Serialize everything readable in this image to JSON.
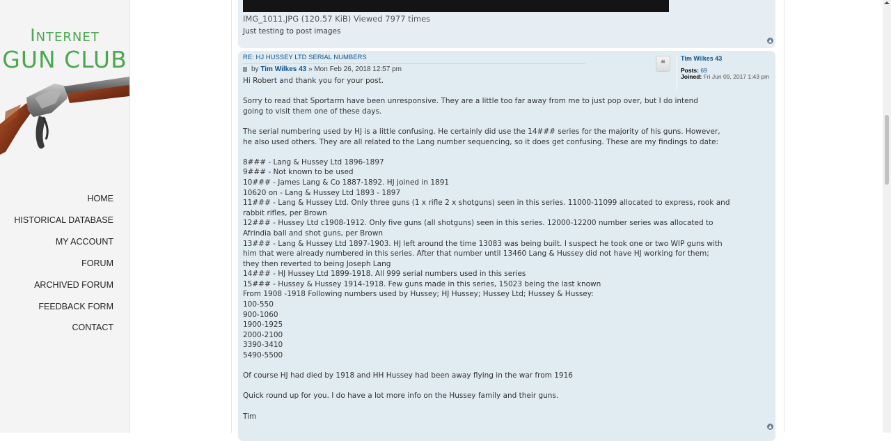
{
  "logo": {
    "line1": "Internet",
    "line2": "GUN CLUB"
  },
  "nav": {
    "home": "HOME",
    "historical_database": "HISTORICAL DATABASE",
    "my_account": "MY ACCOUNT",
    "forum": "FORUM",
    "archived_forum": "ARCHIVED FORUM",
    "feedback_form": "FEEDBACK FORM",
    "contact": "CONTACT"
  },
  "post1": {
    "attachment_caption": "IMG_1011.JPG (120.57 KiB) Viewed 7977 times",
    "text": "Just testing to post images"
  },
  "post2": {
    "title": "Re: HJ Hussey Ltd serial numbers",
    "by_label": "by",
    "author": "Tim Wilkes 43",
    "date": "» Mon Feb 26, 2018 12:57 pm",
    "quote_icon": "quote-icon",
    "profile": {
      "name": "Tim Wilkes 43",
      "posts_label": "Posts:",
      "posts_count": "69",
      "joined_label": "Joined:",
      "joined_date": "Fri Jun 09, 2017 1:43 pm"
    },
    "body_lines": [
      "Hi Robert and thank you for your post.",
      "",
      "Sorry to read that Sportarm have been unresponsive. They are a little too far away from me to just pop over, but I do intend",
      "going to visit them one of these days.",
      "",
      "The serial numbering used by HJ is a little confusing. He certainly did use the 14### series for the majority of his guns. However,",
      "he also used others. They are all related to the Lang number sequencing, so it does get confusing. These are my findings to date:",
      "",
      "8### - Lang & Hussey Ltd 1896-1897",
      "9### - Not known to be used",
      "10### - James Lang & Co 1887-1892. HJ joined in 1891",
      "10620 on - Lang & Hussey Ltd 1893 - 1897",
      "11### - Lang & Hussey Ltd. Only three guns (1 x rifle 2 x shotguns) seen in this series. 11000-11099 allocated to express, rook and",
      "rabbit rifles, per Brown",
      "12### - Hussey Ltd c1908-1912. Only five guns (all shotguns) seen in this series. 12000-12200 number series was allocated to",
      "Afrindia ball and shot guns, per Brown",
      "13### - Lang & Hussey Ltd 1897-1903. HJ left around the time 13083 was being built. I suspect he took one or two WIP guns with",
      "him that were already numbered in this series. After that number until 13460 Lang & Hussey did not have HJ working for them;",
      "they then reverted to being Joseph Lang",
      "14### - HJ Hussey Ltd 1899-1918. All 999 serial numbers used in this series",
      "15### - Hussey & Hussey 1914-1918. Few guns made in this series, 15023 being the last known",
      "From 1908 -1918 Following numbers used by Hussey; HJ Hussey; Hussey Ltd; Hussey & Hussey:",
      "100-550",
      "900-1060",
      "1900-1925",
      "2000-2100",
      "3390-3410",
      "5490-5500",
      "",
      "Of course HJ had died by 1918 and HH Hussey had been away flying in the war from 1916",
      "",
      "Quick round up for you. I do have a lot more info on the Hussey family and their guns.",
      "",
      "Tim"
    ]
  },
  "colors": {
    "logo_green": "#4ba84e",
    "post_bg": "#e1ebf2",
    "link_blue": "#105289"
  }
}
